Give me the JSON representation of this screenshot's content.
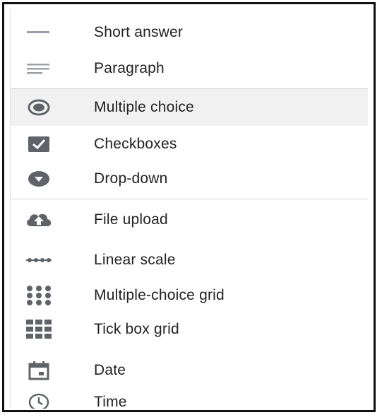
{
  "question_type_menu": {
    "items": [
      {
        "label": "Short answer",
        "icon": "short-answer-icon"
      },
      {
        "label": "Paragraph",
        "icon": "paragraph-icon"
      },
      {
        "label": "Multiple choice",
        "icon": "radio-button-icon",
        "selected": true
      },
      {
        "label": "Checkboxes",
        "icon": "checkbox-icon"
      },
      {
        "label": "Drop-down",
        "icon": "dropdown-icon"
      },
      {
        "label": "File upload",
        "icon": "cloud-upload-icon"
      },
      {
        "label": "Linear scale",
        "icon": "linear-scale-icon"
      },
      {
        "label": "Multiple-choice grid",
        "icon": "radio-grid-icon"
      },
      {
        "label": "Tick box grid",
        "icon": "checkbox-grid-icon"
      },
      {
        "label": "Date",
        "icon": "calendar-icon"
      },
      {
        "label": "Time",
        "icon": "clock-icon"
      }
    ]
  },
  "colors": {
    "icon": "#5f6368",
    "text": "#222222",
    "selected_background": "#f1f1f1",
    "divider": "#d6d6d6"
  }
}
